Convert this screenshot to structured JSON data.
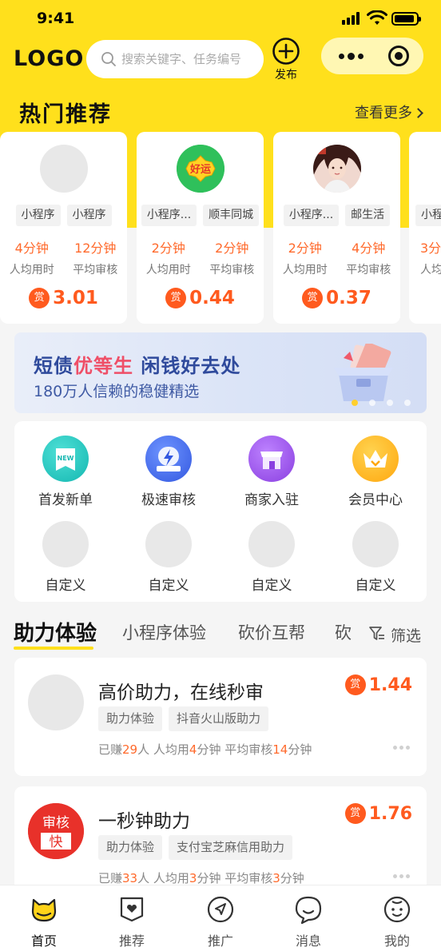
{
  "status_bar": {
    "time": "9:41"
  },
  "header": {
    "logo": "LOGO",
    "search_placeholder": "搜索关键字、任务编号",
    "publish_label": "发布"
  },
  "hot": {
    "title": "热门推荐",
    "more": "查看更多",
    "cards": [
      {
        "avatar": "blank",
        "tags": [
          "小程序",
          "小程序"
        ],
        "time1": "4分钟",
        "label1": "人均用时",
        "time2": "12分钟",
        "label2": "平均审核",
        "reward_icon": "赏",
        "price": "3.01"
      },
      {
        "avatar": "haoyun",
        "avatar_text": "好运",
        "tags": [
          "小程序...",
          "顺丰同城"
        ],
        "time1": "2分钟",
        "label1": "人均用时",
        "time2": "2分钟",
        "label2": "平均审核",
        "reward_icon": "赏",
        "price": "0.44"
      },
      {
        "avatar": "girl-photo",
        "tags": [
          "小程序...",
          "邮生活"
        ],
        "time1": "2分钟",
        "label1": "人均用时",
        "time2": "4分钟",
        "label2": "平均审核",
        "reward_icon": "赏",
        "price": "0.37"
      },
      {
        "avatar": "blank",
        "tags": [
          "小程"
        ],
        "time1": "3分",
        "label1": "人均",
        "time2": "",
        "label2": "",
        "reward_icon": "",
        "price": ""
      }
    ]
  },
  "banner": {
    "line1_a": "短债",
    "line1_b": "优等生",
    "line1_c": " 闲钱好去处",
    "line2": "180万人信赖的稳健精选"
  },
  "menu": [
    {
      "label": "首发新单",
      "icon": "new-order-icon",
      "color": "#19c6c0",
      "badge": "NEW"
    },
    {
      "label": "极速审核",
      "icon": "fast-review-icon",
      "color": "#4a72f0",
      "badge": ""
    },
    {
      "label": "商家入驻",
      "icon": "merchant-icon",
      "color": "#9a52e8",
      "badge": ""
    },
    {
      "label": "会员中心",
      "icon": "vip-crown-icon",
      "color": "#ffb11d",
      "badge": ""
    },
    {
      "label": "自定义",
      "icon": "custom-icon",
      "color": "#e8e8e8",
      "badge": ""
    },
    {
      "label": "自定义",
      "icon": "custom-icon",
      "color": "#e8e8e8",
      "badge": ""
    },
    {
      "label": "自定义",
      "icon": "custom-icon",
      "color": "#e8e8e8",
      "badge": ""
    },
    {
      "label": "自定义",
      "icon": "custom-icon",
      "color": "#e8e8e8",
      "badge": ""
    }
  ],
  "tabs": [
    "助力体验",
    "小程序体验",
    "砍价互帮",
    "砍"
  ],
  "filter_label": "筛选",
  "tasks": [
    {
      "title": "高价助力，在线秒审",
      "reward_icon": "赏",
      "price": "1.44",
      "tags": [
        "助力体验",
        "抖音火山版助力"
      ],
      "meta": {
        "earned_pre": "已赚",
        "earned": "29",
        "earned_post": "人  人均用",
        "avg": "4",
        "avg_post": "分钟  平均审核",
        "review": "14",
        "review_post": "分钟"
      }
    },
    {
      "title": "一秒钟助力",
      "reward_icon": "赏",
      "price": "1.76",
      "avatar_text_top": "审核",
      "avatar_text_bottom": "快",
      "tags": [
        "助力体验",
        "支付宝芝麻信用助力"
      ],
      "meta": {
        "earned_pre": "已赚",
        "earned": "33",
        "earned_post": "人  人均用",
        "avg": "3",
        "avg_post": "分钟  平均审核",
        "review": "3",
        "review_post": "分钟"
      }
    }
  ],
  "nav": [
    {
      "label": "首页",
      "icon": "home-cat-icon",
      "active": true
    },
    {
      "label": "推荐",
      "icon": "recommend-icon",
      "active": false
    },
    {
      "label": "推广",
      "icon": "promote-icon",
      "active": false
    },
    {
      "label": "消息",
      "icon": "message-icon",
      "active": false
    },
    {
      "label": "我的",
      "icon": "profile-icon",
      "active": false
    }
  ],
  "colors": {
    "brand_yellow": "#ffe01c",
    "accent_orange": "#ff5a1e"
  }
}
